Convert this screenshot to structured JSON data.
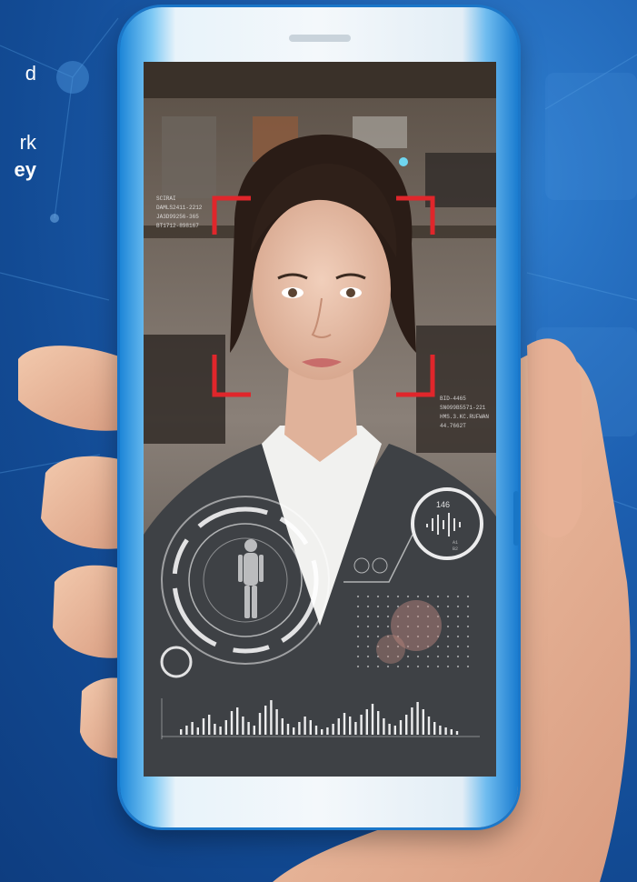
{
  "headline": {
    "line1": "d",
    "line2": "rk",
    "line3": "ey"
  },
  "hud": {
    "code_left": [
      "SCIRAI",
      "DAMLS2411-2212",
      "JA3D99256-365",
      "BT1712-898167"
    ],
    "code_right": [
      "BID-4465",
      "SN099B5571-221",
      "HMS.3.KC.RUFWAN",
      "44.7662T"
    ],
    "waveform_number": "146",
    "waveform_sub": [
      "A1",
      "B2"
    ]
  },
  "colors": {
    "background": "#1d5fb0",
    "phone_frame": "#1b77c9",
    "face_frame": "#e0262b",
    "hud": "#ffffff"
  },
  "icons": [
    "network-background",
    "face-scan-frame",
    "body-scan-dial",
    "audio-wave-circle",
    "bar-spectrum",
    "hand"
  ]
}
